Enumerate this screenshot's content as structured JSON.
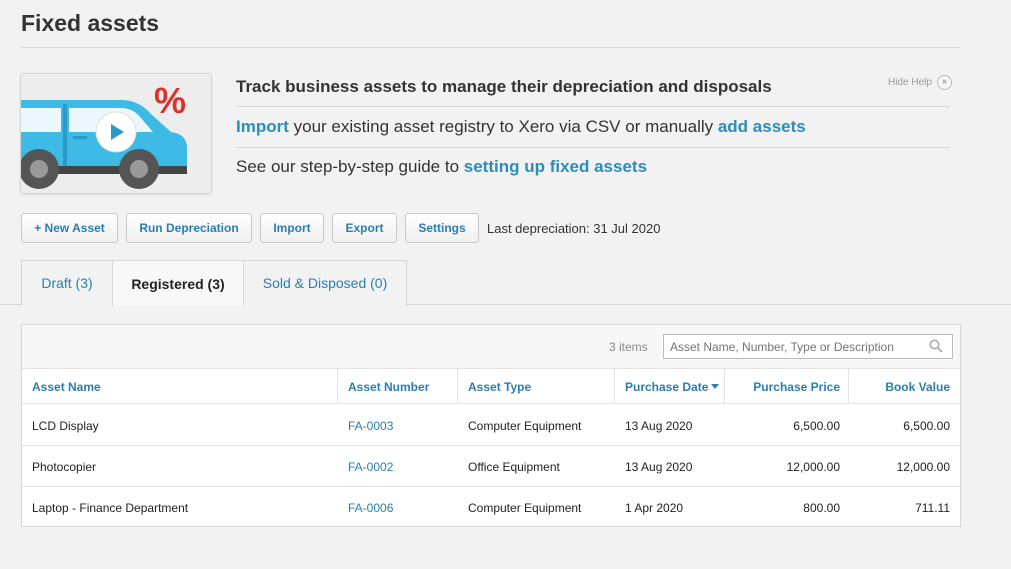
{
  "page": {
    "title": "Fixed assets"
  },
  "help": {
    "heading": "Track business assets to manage their depreciation and disposals",
    "line2_link1": "Import",
    "line2_text": " your existing asset registry to Xero via CSV or manually ",
    "line2_link2": "add assets",
    "line3_text": "See our step-by-step guide to ",
    "line3_link": "setting up fixed assets",
    "hide_label": "Hide Help",
    "close_glyph": "×",
    "video_badge": "%"
  },
  "toolbar": {
    "new_asset": "+ New Asset",
    "run_depreciation": "Run Depreciation",
    "import": "Import",
    "export": "Export",
    "settings": "Settings",
    "last_depreciation": "Last depreciation: 31 Jul 2020"
  },
  "tabs": [
    {
      "label": "Draft (3)"
    },
    {
      "label": "Registered (3)",
      "active": true
    },
    {
      "label": "Sold & Disposed (0)"
    }
  ],
  "table": {
    "count": "3 items",
    "search_placeholder": "Asset Name, Number, Type or Description",
    "columns": [
      "Asset Name",
      "Asset Number",
      "Asset Type",
      "Purchase Date",
      "Purchase Price",
      "Book Value"
    ],
    "sorted_column": "Purchase Date",
    "rows": [
      [
        "LCD Display",
        "FA-0003",
        "Computer Equipment",
        "13 Aug 2020",
        "6,500.00",
        "6,500.00"
      ],
      [
        "Photocopier",
        "FA-0002",
        "Office Equipment",
        "13 Aug 2020",
        "12,000.00",
        "12,000.00"
      ],
      [
        "Laptop - Finance Department",
        "FA-0006",
        "Computer Equipment",
        "1 Apr 2020",
        "800.00",
        "711.11"
      ]
    ]
  },
  "colors": {
    "accent": "#2a7fae",
    "car": "#3dbbe6",
    "badge": "#d9342b"
  }
}
